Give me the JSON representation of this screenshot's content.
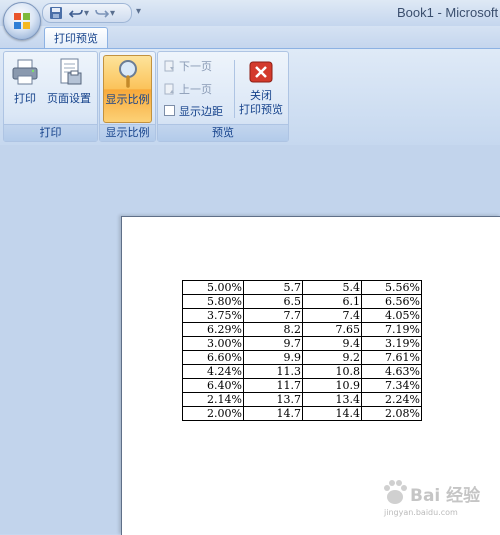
{
  "window": {
    "title": "Book1 - Microsoft"
  },
  "icons": {
    "office_button": "office-logo-icon",
    "qat": [
      "save-icon",
      "undo-icon",
      "redo-icon",
      "customize-qat-icon"
    ],
    "print": "printer-icon",
    "page_setup": "page-setup-icon",
    "zoom": "magnifier-icon",
    "next_page": "next-page-icon",
    "prev_page": "previous-page-icon",
    "close": "close-red-x-icon"
  },
  "ribbon": {
    "active_tab": "打印预览",
    "groups": {
      "print": {
        "label": "打印",
        "print_button": "打印",
        "page_setup_button": "页面设置"
      },
      "zoom": {
        "label": "显示比例",
        "zoom_button": "显示比例"
      },
      "preview": {
        "label": "预览",
        "next_page": "下一页",
        "prev_page": "上一页",
        "show_margins": "显示边距",
        "show_margins_checked": false,
        "close_line1": "关闭",
        "close_line2": "打印预览"
      }
    }
  },
  "sheet": {
    "rows": [
      [
        "5.00%",
        "5.7",
        "5.4",
        "5.56%"
      ],
      [
        "5.80%",
        "6.5",
        "6.1",
        "6.56%"
      ],
      [
        "3.75%",
        "7.7",
        "7.4",
        "4.05%"
      ],
      [
        "6.29%",
        "8.2",
        "7.65",
        "7.19%"
      ],
      [
        "3.00%",
        "9.7",
        "9.4",
        "3.19%"
      ],
      [
        "6.60%",
        "9.9",
        "9.2",
        "7.61%"
      ],
      [
        "4.24%",
        "11.3",
        "10.8",
        "4.63%"
      ],
      [
        "6.40%",
        "11.7",
        "10.9",
        "7.34%"
      ],
      [
        "2.14%",
        "13.7",
        "13.4",
        "2.24%"
      ],
      [
        "2.00%",
        "14.7",
        "14.4",
        "2.08%"
      ]
    ]
  },
  "watermark": {
    "brand": "Bai 经验",
    "url": "jingyan.baidu.com"
  },
  "colors": {
    "ribbon_accent": "#15428b",
    "active_button": "#fbc35a",
    "close_red": "#d33a2c",
    "workspace": "#c2d4ec"
  }
}
